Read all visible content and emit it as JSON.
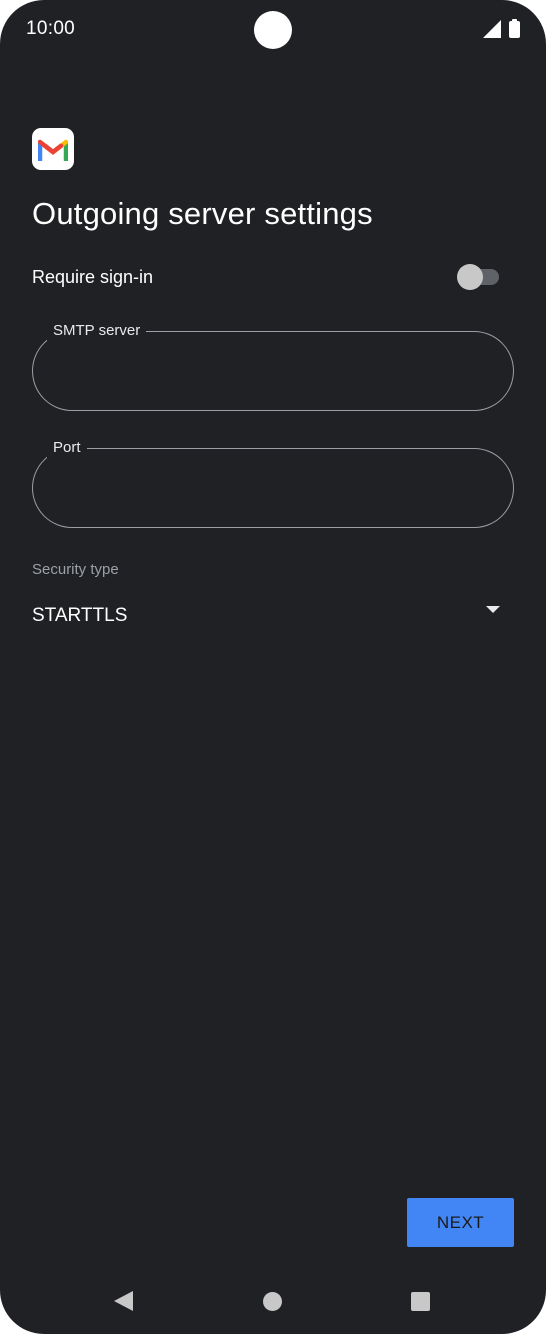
{
  "status_bar": {
    "time": "10:00",
    "icons": [
      "signal-icon",
      "battery-icon"
    ]
  },
  "app": {
    "icon": "gmail-icon",
    "colors": {
      "red": "#ea4335",
      "blue": "#4285f4",
      "green": "#34a853",
      "yellow": "#fbbc04"
    }
  },
  "page": {
    "title": "Outgoing server settings"
  },
  "require_signin": {
    "label": "Require sign-in",
    "enabled": false
  },
  "smtp_server": {
    "label": "SMTP server",
    "value": ""
  },
  "port": {
    "label": "Port",
    "value": ""
  },
  "security_type": {
    "label": "Security type",
    "selected": "STARTTLS"
  },
  "actions": {
    "next_label": "NEXT",
    "accent": "#4285f4"
  },
  "nav_bar": {
    "icons": [
      "back-icon",
      "home-icon",
      "recents-icon"
    ]
  },
  "theme": {
    "background": "#202124"
  }
}
